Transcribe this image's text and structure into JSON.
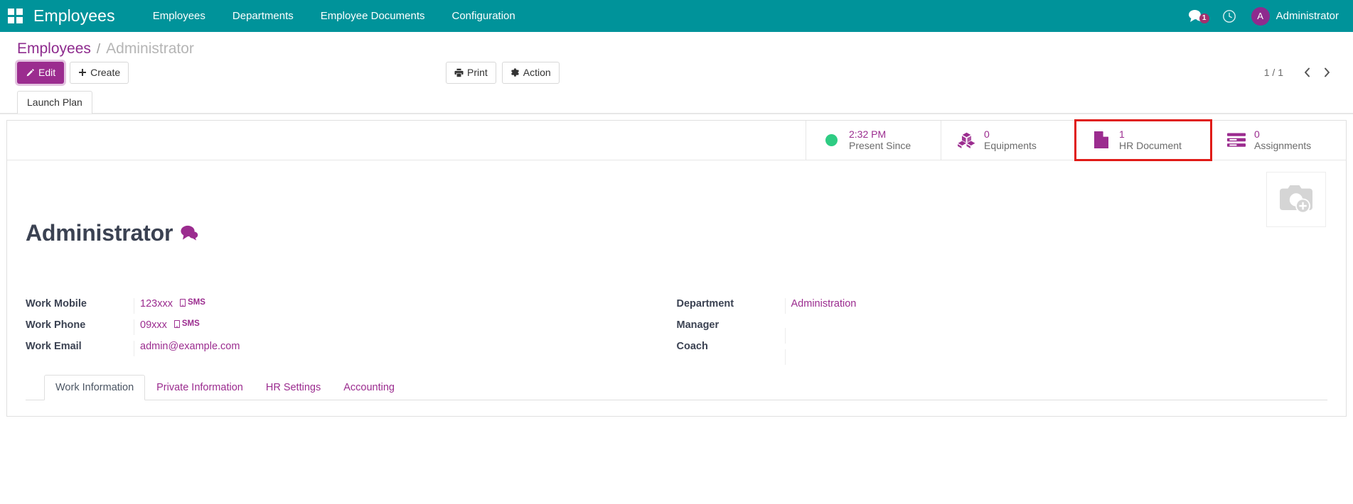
{
  "navbar": {
    "apps_icon": "apps-grid-icon",
    "brand": "Employees",
    "menu": [
      {
        "label": "Employees"
      },
      {
        "label": "Departments"
      },
      {
        "label": "Employee Documents"
      },
      {
        "label": "Configuration"
      }
    ],
    "messages_icon": "messages-icon",
    "messages_count": "1",
    "activity_icon": "clock-icon",
    "avatar_initial": "A",
    "user_name": "Administrator"
  },
  "breadcrumb": {
    "root": "Employees",
    "separator": "/",
    "current": "Administrator"
  },
  "control_panel": {
    "edit_label": "Edit",
    "edit_icon": "pencil-icon",
    "create_label": "Create",
    "create_icon": "plus-icon",
    "print_label": "Print",
    "print_icon": "printer-icon",
    "action_label": "Action",
    "action_icon": "gear-icon",
    "pager_value": "1 / 1",
    "prev_icon": "chevron-left-icon",
    "next_icon": "chevron-right-icon",
    "launch_plan_label": "Launch Plan"
  },
  "stat_buttons": [
    {
      "icon": "green-status-dot-icon",
      "value": "2:32 PM",
      "label": "Present Since",
      "highlighted": false
    },
    {
      "icon": "equipment-boxes-icon",
      "value": "0",
      "label": "Equipments",
      "highlighted": false
    },
    {
      "icon": "document-icon",
      "value": "1",
      "label": "HR Document",
      "highlighted": true
    },
    {
      "icon": "assignments-list-icon",
      "value": "0",
      "label": "Assignments",
      "highlighted": false
    }
  ],
  "record": {
    "image_placeholder_icon": "camera-add-icon",
    "name": "Administrator",
    "chatter_icon": "comment-bubbles-icon",
    "left_fields": [
      {
        "label": "Work Mobile",
        "value": "123xxx",
        "action_label": "SMS",
        "action_icon": "mobile-icon"
      },
      {
        "label": "Work Phone",
        "value": "09xxx",
        "action_label": "SMS",
        "action_icon": "mobile-icon"
      },
      {
        "label": "Work Email",
        "value": "admin@example.com",
        "action_label": "",
        "action_icon": ""
      }
    ],
    "right_fields": [
      {
        "label": "Department",
        "value": "Administration"
      },
      {
        "label": "Manager",
        "value": ""
      },
      {
        "label": "Coach",
        "value": ""
      }
    ]
  },
  "notebook_tabs": [
    {
      "label": "Work Information",
      "active": true
    },
    {
      "label": "Private Information",
      "active": false
    },
    {
      "label": "HR Settings",
      "active": false
    },
    {
      "label": "Accounting",
      "active": false
    }
  ],
  "colors": {
    "navbar": "#00939a",
    "accent": "#9b2c8f",
    "highlight": "#e01b17",
    "status_green": "#2ecc83"
  }
}
